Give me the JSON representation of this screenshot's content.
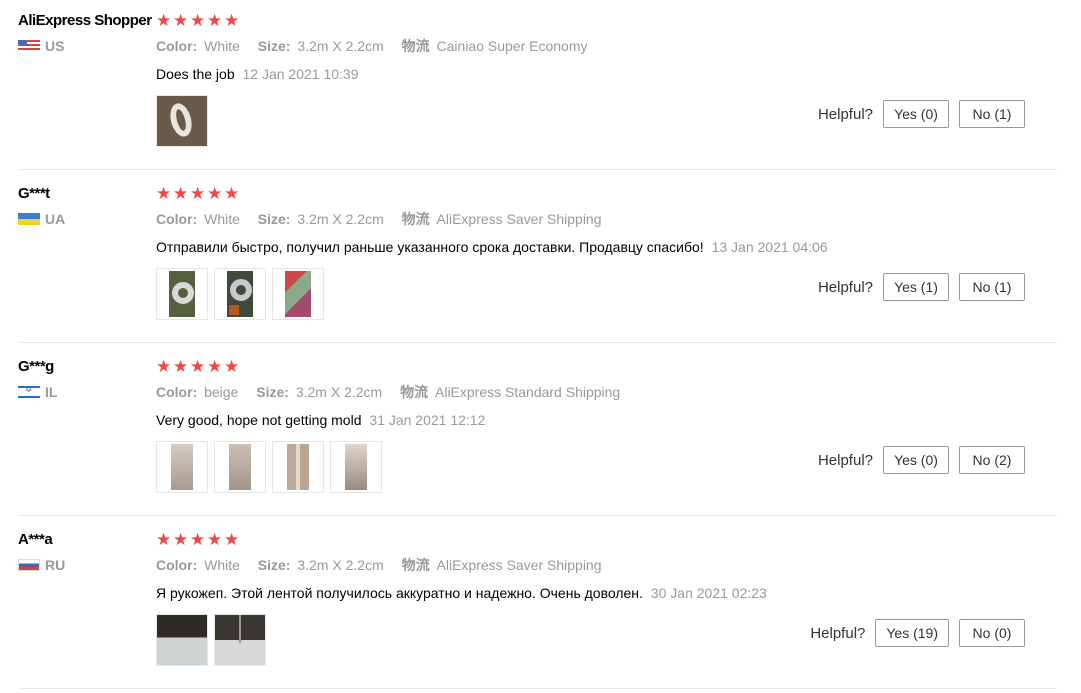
{
  "labels": {
    "color": "Color:",
    "size": "Size:",
    "shipping": "物流",
    "helpful": "Helpful?"
  },
  "colors": {
    "star": "#f04848",
    "muted": "#999999",
    "divider": "#e8e8e8"
  },
  "reviews": [
    {
      "user": "AliExpress Shopper",
      "country": "US",
      "flag_icon": "us-flag-icon",
      "rating": 5,
      "color": "White",
      "size": "3.2m X 2.2cm",
      "shipping": "Cainiao Super Economy",
      "text": "Does the job",
      "time": "12 Jan 2021 10:39",
      "photo_count": 1,
      "yes": "Yes (0)",
      "no": "No (1)"
    },
    {
      "user": "G***t",
      "country": "UA",
      "flag_icon": "ua-flag-icon",
      "rating": 5,
      "color": "White",
      "size": "3.2m X 2.2cm",
      "shipping": "AliExpress Saver Shipping",
      "text": "Отправили быстро, получил раньше указанного срока доставки. Продавцу спасибо!",
      "time": "13 Jan 2021 04:06",
      "photo_count": 3,
      "yes": "Yes (1)",
      "no": "No (1)"
    },
    {
      "user": "G***g",
      "country": "IL",
      "flag_icon": "il-flag-icon",
      "rating": 5,
      "color": "beige",
      "size": "3.2m X 2.2cm",
      "shipping": "AliExpress Standard Shipping",
      "text": "Very good, hope not getting mold",
      "time": "31 Jan 2021 12:12",
      "photo_count": 4,
      "yes": "Yes (0)",
      "no": "No (2)"
    },
    {
      "user": "A***a",
      "country": "RU",
      "flag_icon": "ru-flag-icon",
      "rating": 5,
      "color": "White",
      "size": "3.2m X 2.2cm",
      "shipping": "AliExpress Saver Shipping",
      "text": "Я рукожеп. Этой лентой получилось аккуратно и надежно. Очень доволен.",
      "time": "30 Jan 2021 02:23",
      "photo_count": 2,
      "yes": "Yes (19)",
      "no": "No (0)"
    }
  ]
}
